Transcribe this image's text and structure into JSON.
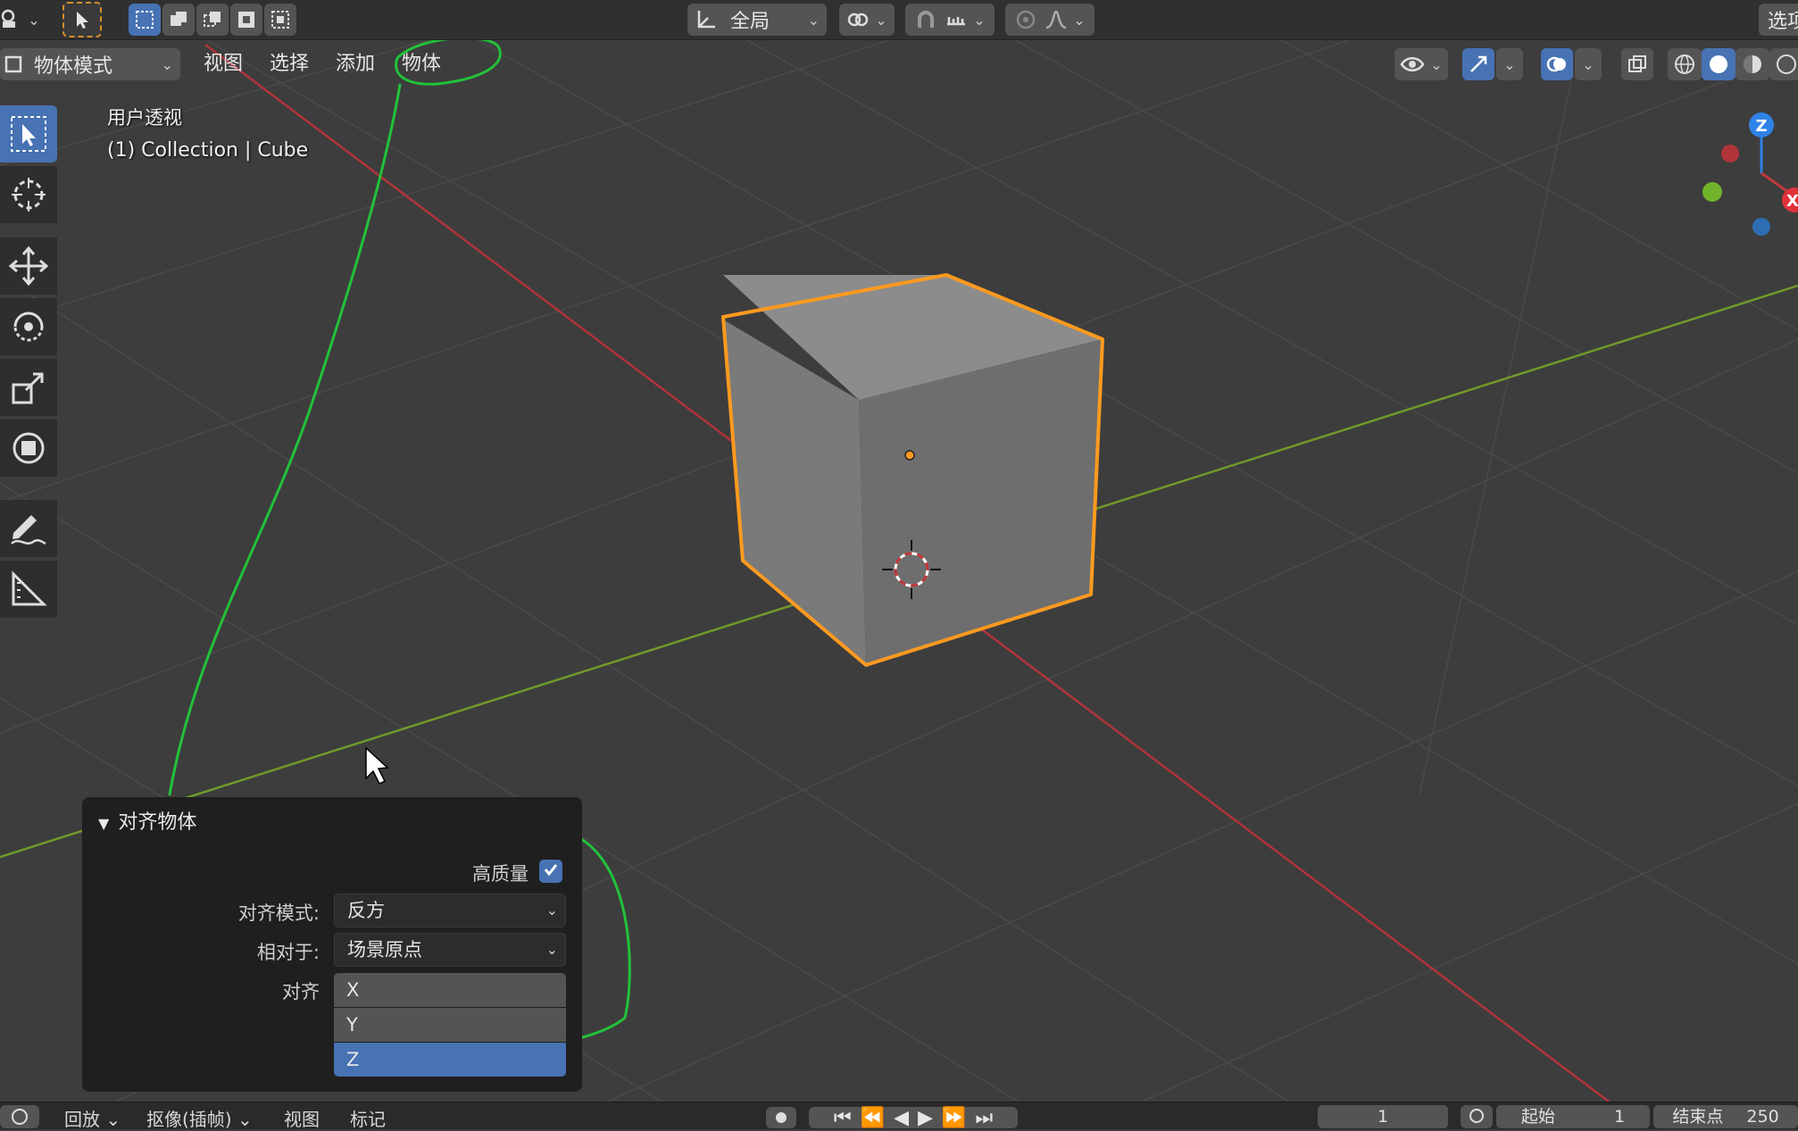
{
  "header": {
    "transform_orientation": "全局",
    "options_label": "选项"
  },
  "viewport_header": {
    "mode": "物体模式",
    "menus": [
      "视图",
      "选择",
      "添加",
      "物体"
    ]
  },
  "overlay": {
    "view_name": "用户透视",
    "collection_info": "(1) Collection | Cube"
  },
  "gizmo": {
    "z_label": "Z",
    "x_label": "X"
  },
  "operator_panel": {
    "title": "对齐物体",
    "high_quality_label": "高质量",
    "high_quality_checked": true,
    "align_mode_label": "对齐模式:",
    "align_mode_value": "反方",
    "relative_to_label": "相对于:",
    "relative_to_value": "场景原点",
    "align_label": "对齐",
    "axes": [
      {
        "label": "X",
        "selected": false
      },
      {
        "label": "Y",
        "selected": false
      },
      {
        "label": "Z",
        "selected": true
      }
    ]
  },
  "timeline": {
    "playback": "回放",
    "keying": "抠像(插帧)",
    "view": "视图",
    "marker": "标记",
    "current_frame": "1",
    "start_label": "起始",
    "start_value": "1",
    "end_label": "结束点",
    "end_value": "250"
  },
  "colors": {
    "accent": "#4772b3",
    "selection_outline": "#ff9a1f",
    "annotation": "#22c23a",
    "x_axis": "#b0343a",
    "y_axis": "#6f9a2a"
  }
}
